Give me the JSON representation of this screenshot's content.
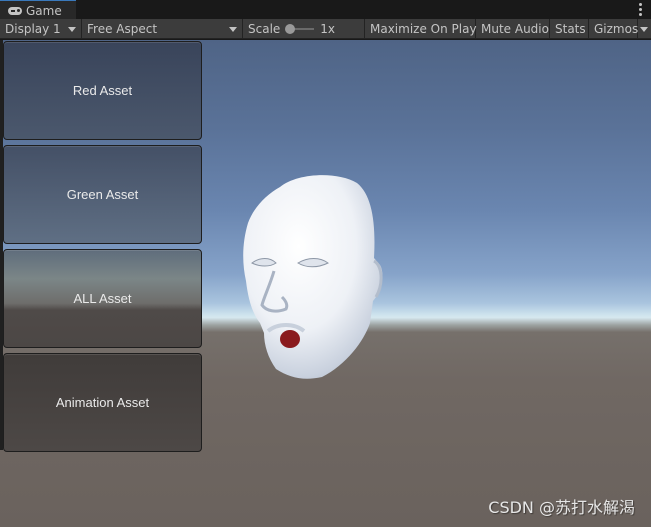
{
  "window": {
    "tab_label": "Game",
    "tab_icon": "gamepad-icon",
    "menu_icon": "kebab-menu-icon"
  },
  "toolbar": {
    "display": "Display 1",
    "aspect": "Free Aspect",
    "scale_label": "Scale",
    "scale_value": "1x",
    "maximize": "Maximize On Play",
    "mute": "Mute Audio",
    "stats": "Stats",
    "gizmos": "Gizmos"
  },
  "buttons": [
    {
      "label": "Red Asset"
    },
    {
      "label": "Green Asset"
    },
    {
      "label": "ALL Asset"
    },
    {
      "label": "Animation Asset"
    }
  ],
  "scene": {
    "object": "head-model",
    "sky_color": "#5a7298",
    "ground_color": "#706863",
    "mouth_color": "#8a1a1e"
  },
  "watermark": "CSDN @苏打水解渴"
}
